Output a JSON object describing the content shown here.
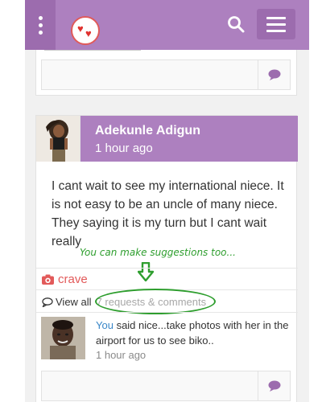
{
  "header": {
    "search_icon": "search-icon",
    "menu_icon": "hamburger-icon",
    "options_icon": "kebab-icon",
    "brand_color": "#ad80bf"
  },
  "previous_post": {
    "comment_button_icon": "comment-icon"
  },
  "post": {
    "author": "Adekunle Adigun",
    "time": "1 hour ago",
    "body": "I cant wait to see my international niece. It is not easy to be an uncle of many niece. They saying it is my turn but I cant wait really",
    "crave_label": "crave",
    "view_all_label": "View all",
    "comments_count_label": "7 requests & comments"
  },
  "annotation": {
    "text": "You can make suggestions too..."
  },
  "reply": {
    "author": "You",
    "text": "said nice...take photos with her in the airport for us to see biko..",
    "time": "1 hour ago"
  }
}
